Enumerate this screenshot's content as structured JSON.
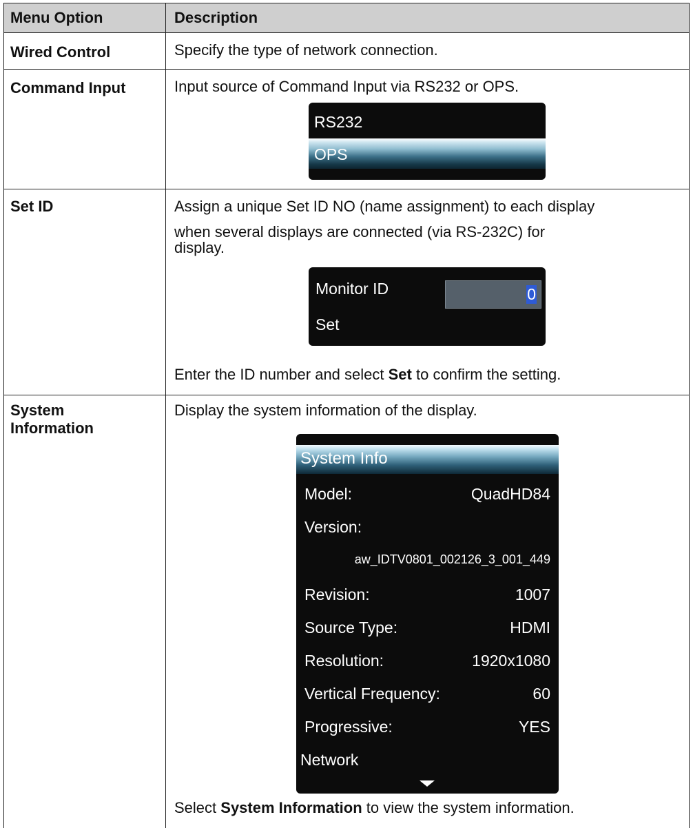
{
  "header": {
    "col1": "Menu Option",
    "col2": "Description"
  },
  "rows": [
    {
      "option": "Wired Control",
      "description": "Specify the type of network connection."
    },
    {
      "option": "Command Input",
      "description": "Input source of Command Input via RS232 or OPS.",
      "osd": {
        "items": [
          "RS232",
          "OPS"
        ],
        "selected": "OPS"
      }
    },
    {
      "option": "Set ID",
      "description_line1": "Assign a unique Set ID NO (name assignment) to each display",
      "description_line2": "when several displays are connected (via RS-232C) for",
      "description_line3": "display.",
      "osd": {
        "label": "Monitor ID",
        "value": "0",
        "action": "Set"
      },
      "footer_pre": "Enter the ID number and select ",
      "footer_bold": "Set",
      "footer_post": " to confirm the setting."
    },
    {
      "option_line1": "System",
      "option_line2": "Information",
      "description": "Display the system information of the display.",
      "osd": {
        "title": "System Info",
        "model_label": "Model:",
        "model_value": "QuadHD84",
        "version_label": "Version:",
        "version_value": "aw_IDTV0801_002126_3_001_449",
        "revision_label": "Revision:",
        "revision_value": "1007",
        "source_label": "Source Type:",
        "source_value": "HDMI",
        "resolution_label": "Resolution:",
        "resolution_value": "1920x1080",
        "vfreq_label": "Vertical Frequency:",
        "vfreq_value": "60",
        "progressive_label": "Progressive:",
        "progressive_value": "YES",
        "network_label": "Network",
        "more_icon": "chevron-down-icon"
      },
      "footer_pre": "Select ",
      "footer_bold": "System Information",
      "footer_post": " to view the system information."
    }
  ]
}
